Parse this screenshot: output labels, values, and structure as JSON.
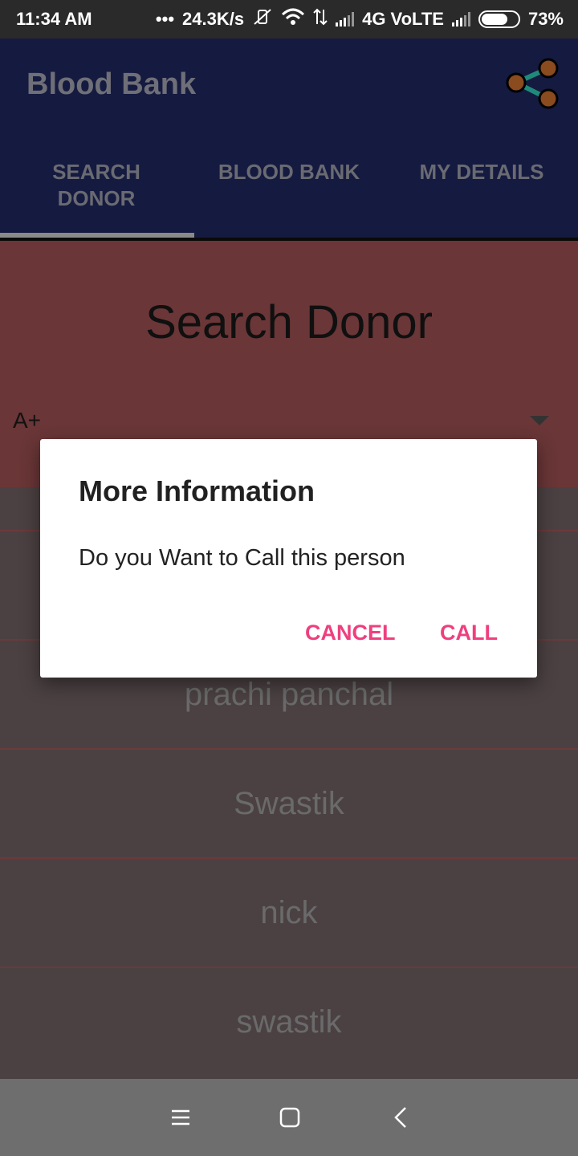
{
  "status_bar": {
    "time": "11:34 AM",
    "network_speed": "24.3K/s",
    "network_type": "4G VoLTE",
    "battery": "73%",
    "battery_level": 0.73
  },
  "app_bar": {
    "title": "Blood Bank",
    "share_icon": "share-icon"
  },
  "tabs": [
    {
      "label": "SEARCH\nDONOR",
      "selected": true
    },
    {
      "label": "BLOOD BANK",
      "selected": false
    },
    {
      "label": "MY DETAILS",
      "selected": false
    }
  ],
  "search": {
    "title": "Search Donor",
    "blood_group": "A+"
  },
  "donors": [
    "",
    "prachi panchal",
    "Swastik",
    "nick",
    "swastik"
  ],
  "dialog": {
    "title": "More Information",
    "message": "Do you Want to Call this person",
    "cancel_label": "CANCEL",
    "call_label": "CALL"
  },
  "colors": {
    "app_bar": "#151a40",
    "search_panel": "#6a3637",
    "accent": "#ef3f7e"
  }
}
